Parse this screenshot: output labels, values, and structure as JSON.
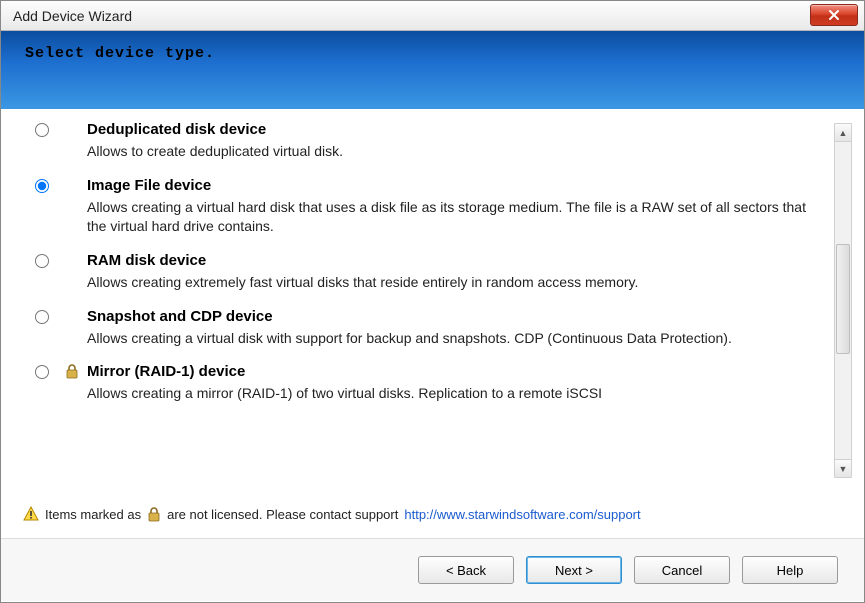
{
  "window": {
    "title": "Add Device Wizard",
    "subtitle": "Select device type."
  },
  "options": [
    {
      "id": "dedup",
      "title": "Deduplicated disk device",
      "desc": "Allows to create deduplicated virtual disk.",
      "locked": false,
      "selected": false
    },
    {
      "id": "imagefile",
      "title": "Image File device",
      "desc": "Allows creating a virtual hard disk that uses a disk file as its storage medium. The file is a RAW set of all sectors that the virtual hard drive contains.",
      "locked": false,
      "selected": true
    },
    {
      "id": "ramdisk",
      "title": "RAM disk device",
      "desc": "Allows creating extremely fast virtual disks that reside entirely in random access memory.",
      "locked": false,
      "selected": false
    },
    {
      "id": "snapshot",
      "title": "Snapshot and CDP device",
      "desc": "Allows creating a virtual disk with support for backup and snapshots. CDP (Continuous Data Protection).",
      "locked": false,
      "selected": false
    },
    {
      "id": "mirror",
      "title": "Mirror (RAID-1) device",
      "desc": "Allows creating a mirror (RAID-1) of two virtual disks. Replication to a remote iSCSI",
      "locked": true,
      "selected": false
    }
  ],
  "footer": {
    "prefix": "Items marked as",
    "suffix": "are not licensed. Please contact support",
    "link_text": "http://www.starwindsoftware.com/support",
    "link_href": "http://www.starwindsoftware.com/support"
  },
  "buttons": {
    "back": "< Back",
    "next": "Next >",
    "cancel": "Cancel",
    "help": "Help"
  }
}
